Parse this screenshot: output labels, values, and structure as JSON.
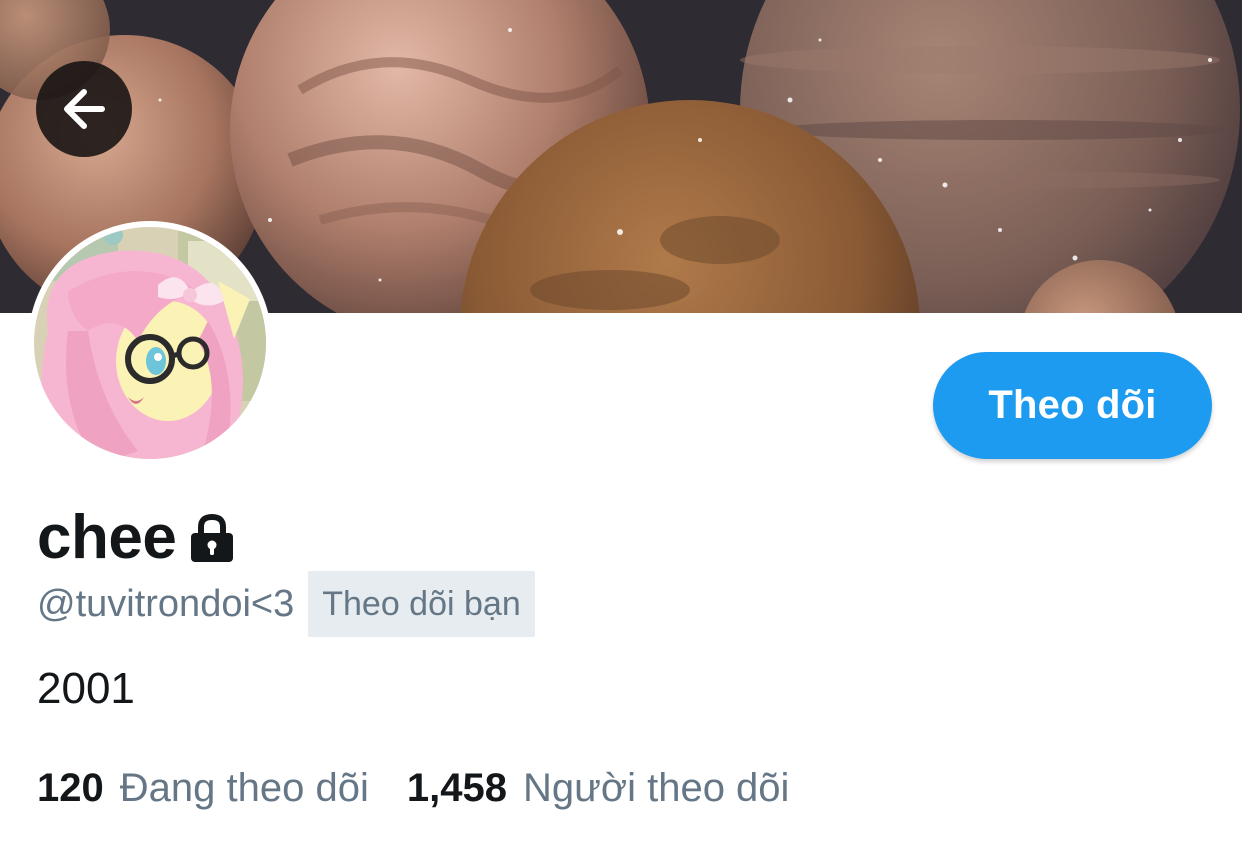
{
  "profile": {
    "display_name": "chee",
    "handle": "@tuvitrondoi<3",
    "follows_you_badge": "Theo dõi bạn",
    "bio": "2001",
    "follow_button_label": "Theo dõi",
    "protected": true
  },
  "stats": {
    "following_count": "120",
    "following_label": "Đang theo dõi",
    "followers_count": "1,458",
    "followers_label": "Người theo dõi"
  },
  "icons": {
    "back": "arrow-left-icon",
    "lock": "lock-icon"
  },
  "colors": {
    "accent": "#1d9bf0",
    "text_primary": "#14171a",
    "text_secondary": "#657786",
    "badge_bg": "#e6ecf0"
  }
}
